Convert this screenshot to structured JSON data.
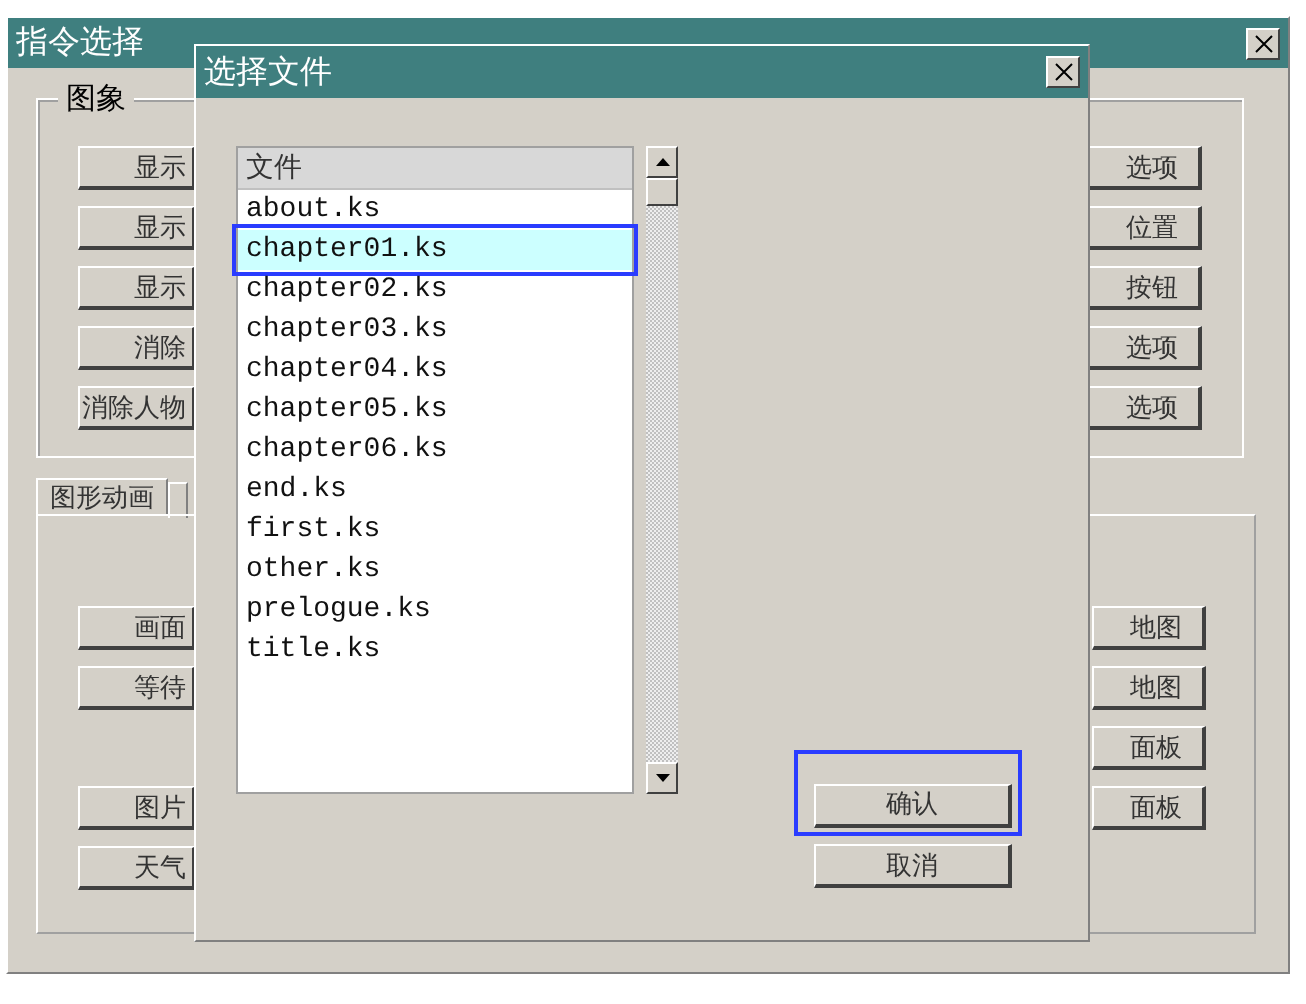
{
  "main_window": {
    "title": "指令选择",
    "image_group": {
      "legend": "图象",
      "left_buttons": [
        "显示",
        "显示",
        "显示",
        "消除",
        "消除人物"
      ],
      "right_buttons": [
        "选项",
        "位置",
        "按钮",
        "选项",
        "选项"
      ]
    },
    "tabs": [
      {
        "label": "图形动画",
        "selected": true
      },
      {
        "selected": false
      }
    ],
    "tab_panel": {
      "left_buttons": [
        "画面",
        "等待",
        "图片",
        "天气"
      ],
      "right_buttons": [
        "地图",
        "地图",
        "面板",
        "面板"
      ]
    }
  },
  "dialog": {
    "title": "选择文件",
    "list": {
      "header": "文件",
      "items": [
        {
          "name": "about.ks",
          "selected": false
        },
        {
          "name": "chapter01.ks",
          "selected": true
        },
        {
          "name": "chapter02.ks",
          "selected": false
        },
        {
          "name": "chapter03.ks",
          "selected": false
        },
        {
          "name": "chapter04.ks",
          "selected": false
        },
        {
          "name": "chapter05.ks",
          "selected": false
        },
        {
          "name": "chapter06.ks",
          "selected": false
        },
        {
          "name": "end.ks",
          "selected": false
        },
        {
          "name": "first.ks",
          "selected": false
        },
        {
          "name": "other.ks",
          "selected": false
        },
        {
          "name": "prelogue.ks",
          "selected": false
        },
        {
          "name": "title.ks",
          "selected": false
        }
      ]
    },
    "buttons": [
      {
        "label": "确认",
        "highlighted": true
      },
      {
        "label": "取消",
        "highlighted": false
      }
    ]
  }
}
